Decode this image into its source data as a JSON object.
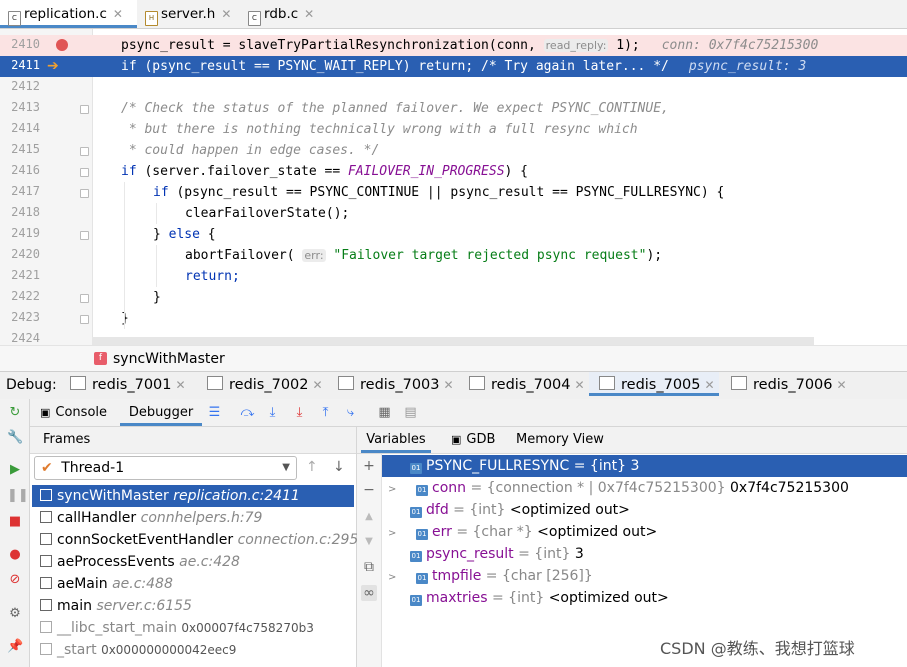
{
  "file_tabs": [
    {
      "label": "replication.c",
      "kind": "c",
      "active": true
    },
    {
      "label": "server.h",
      "kind": "h",
      "active": false
    },
    {
      "label": "rdb.c",
      "kind": "c",
      "active": false
    }
  ],
  "editor": {
    "line_numbers": [
      "2410",
      "2411",
      "2412",
      "2413",
      "2414",
      "2415",
      "2416",
      "2417",
      "2418",
      "2419",
      "2420",
      "2421",
      "2422",
      "2423",
      "2424"
    ],
    "l2410": {
      "code": "psync_result = slaveTryPartialResynchronization(conn, ",
      "hint": "read_reply:",
      "tail": " 1);",
      "inline": "conn: 0x7f4c75215300"
    },
    "l2411": {
      "code": "if (psync_result == PSYNC_WAIT_REPLY) return; /* Try again later... */",
      "inline": "psync_result: 3"
    },
    "l2413": "/* Check the status of the planned failover. We expect PSYNC_CONTINUE,",
    "l2414": " * but there is nothing technically wrong with a full resync which",
    "l2415": " * could happen in edge cases. */",
    "l2416": {
      "kw": "if",
      "pre": " (server.failover_state == ",
      "macro": "FAILOVER_IN_PROGRESS",
      "post": ") {"
    },
    "l2417": {
      "kw": "if",
      "rest": " (psync_result == PSYNC_CONTINUE || psync_result == PSYNC_FULLRESYNC) {"
    },
    "l2418": "clearFailoverState();",
    "l2419": {
      "pre": "} ",
      "kw": "else",
      "post": " {"
    },
    "l2420": {
      "code": "abortFailover( ",
      "hint": "err:",
      "str": " \"Failover target rejected psync request\"",
      "tail": ");"
    },
    "l2421": "return;",
    "l2422": "}",
    "l2423": "}"
  },
  "breadcrumb": {
    "icon": "f",
    "label": "syncWithMaster"
  },
  "debug": {
    "label": "Debug:",
    "sessions": [
      {
        "label": "redis_7001",
        "active": false
      },
      {
        "label": "redis_7002",
        "active": false
      },
      {
        "label": "redis_7003",
        "active": false
      },
      {
        "label": "redis_7004",
        "active": false
      },
      {
        "label": "redis_7005",
        "active": true
      },
      {
        "label": "redis_7006",
        "active": false
      }
    ],
    "console_label": "Console",
    "debugger_label": "Debugger",
    "frames_label": "Frames",
    "thread": "Thread-1",
    "frames": [
      {
        "fn": "syncWithMaster",
        "loc": "replication.c:2411",
        "selected": true
      },
      {
        "fn": "callHandler",
        "loc": "connhelpers.h:79"
      },
      {
        "fn": "connSocketEventHandler",
        "loc": "connection.c:295"
      },
      {
        "fn": "aeProcessEvents",
        "loc": "ae.c:428"
      },
      {
        "fn": "aeMain",
        "loc": "ae.c:488"
      },
      {
        "fn": "main",
        "loc": "server.c:6155"
      },
      {
        "fn": "__libc_start_main",
        "addr": "0x00007f4c758270b3"
      },
      {
        "fn": "_start",
        "addr": "0x000000000042eec9"
      }
    ],
    "var_tabs": [
      "Variables",
      "GDB",
      "Memory View"
    ],
    "variables": [
      {
        "name": "PSYNC_FULLRESYNC",
        "type": "= {int}",
        "value": "3",
        "expandable": false,
        "selected": true
      },
      {
        "name": "conn",
        "type": "= {connection * | 0x7f4c75215300}",
        "value": "0x7f4c75215300",
        "expandable": true
      },
      {
        "name": "dfd",
        "type": "= {int}",
        "value": "<optimized out>",
        "expandable": false
      },
      {
        "name": "err",
        "type": "= {char *}",
        "value": "<optimized out>",
        "expandable": true
      },
      {
        "name": "psync_result",
        "type": "= {int}",
        "value": "3",
        "expandable": false
      },
      {
        "name": "tmpfile",
        "type": "= {char [256]}",
        "value": "",
        "expandable": true
      },
      {
        "name": "maxtries",
        "type": "= {int}",
        "value": "<optimized out>",
        "expandable": false
      }
    ]
  },
  "watermark": "CSDN @教练、我想打篮球"
}
